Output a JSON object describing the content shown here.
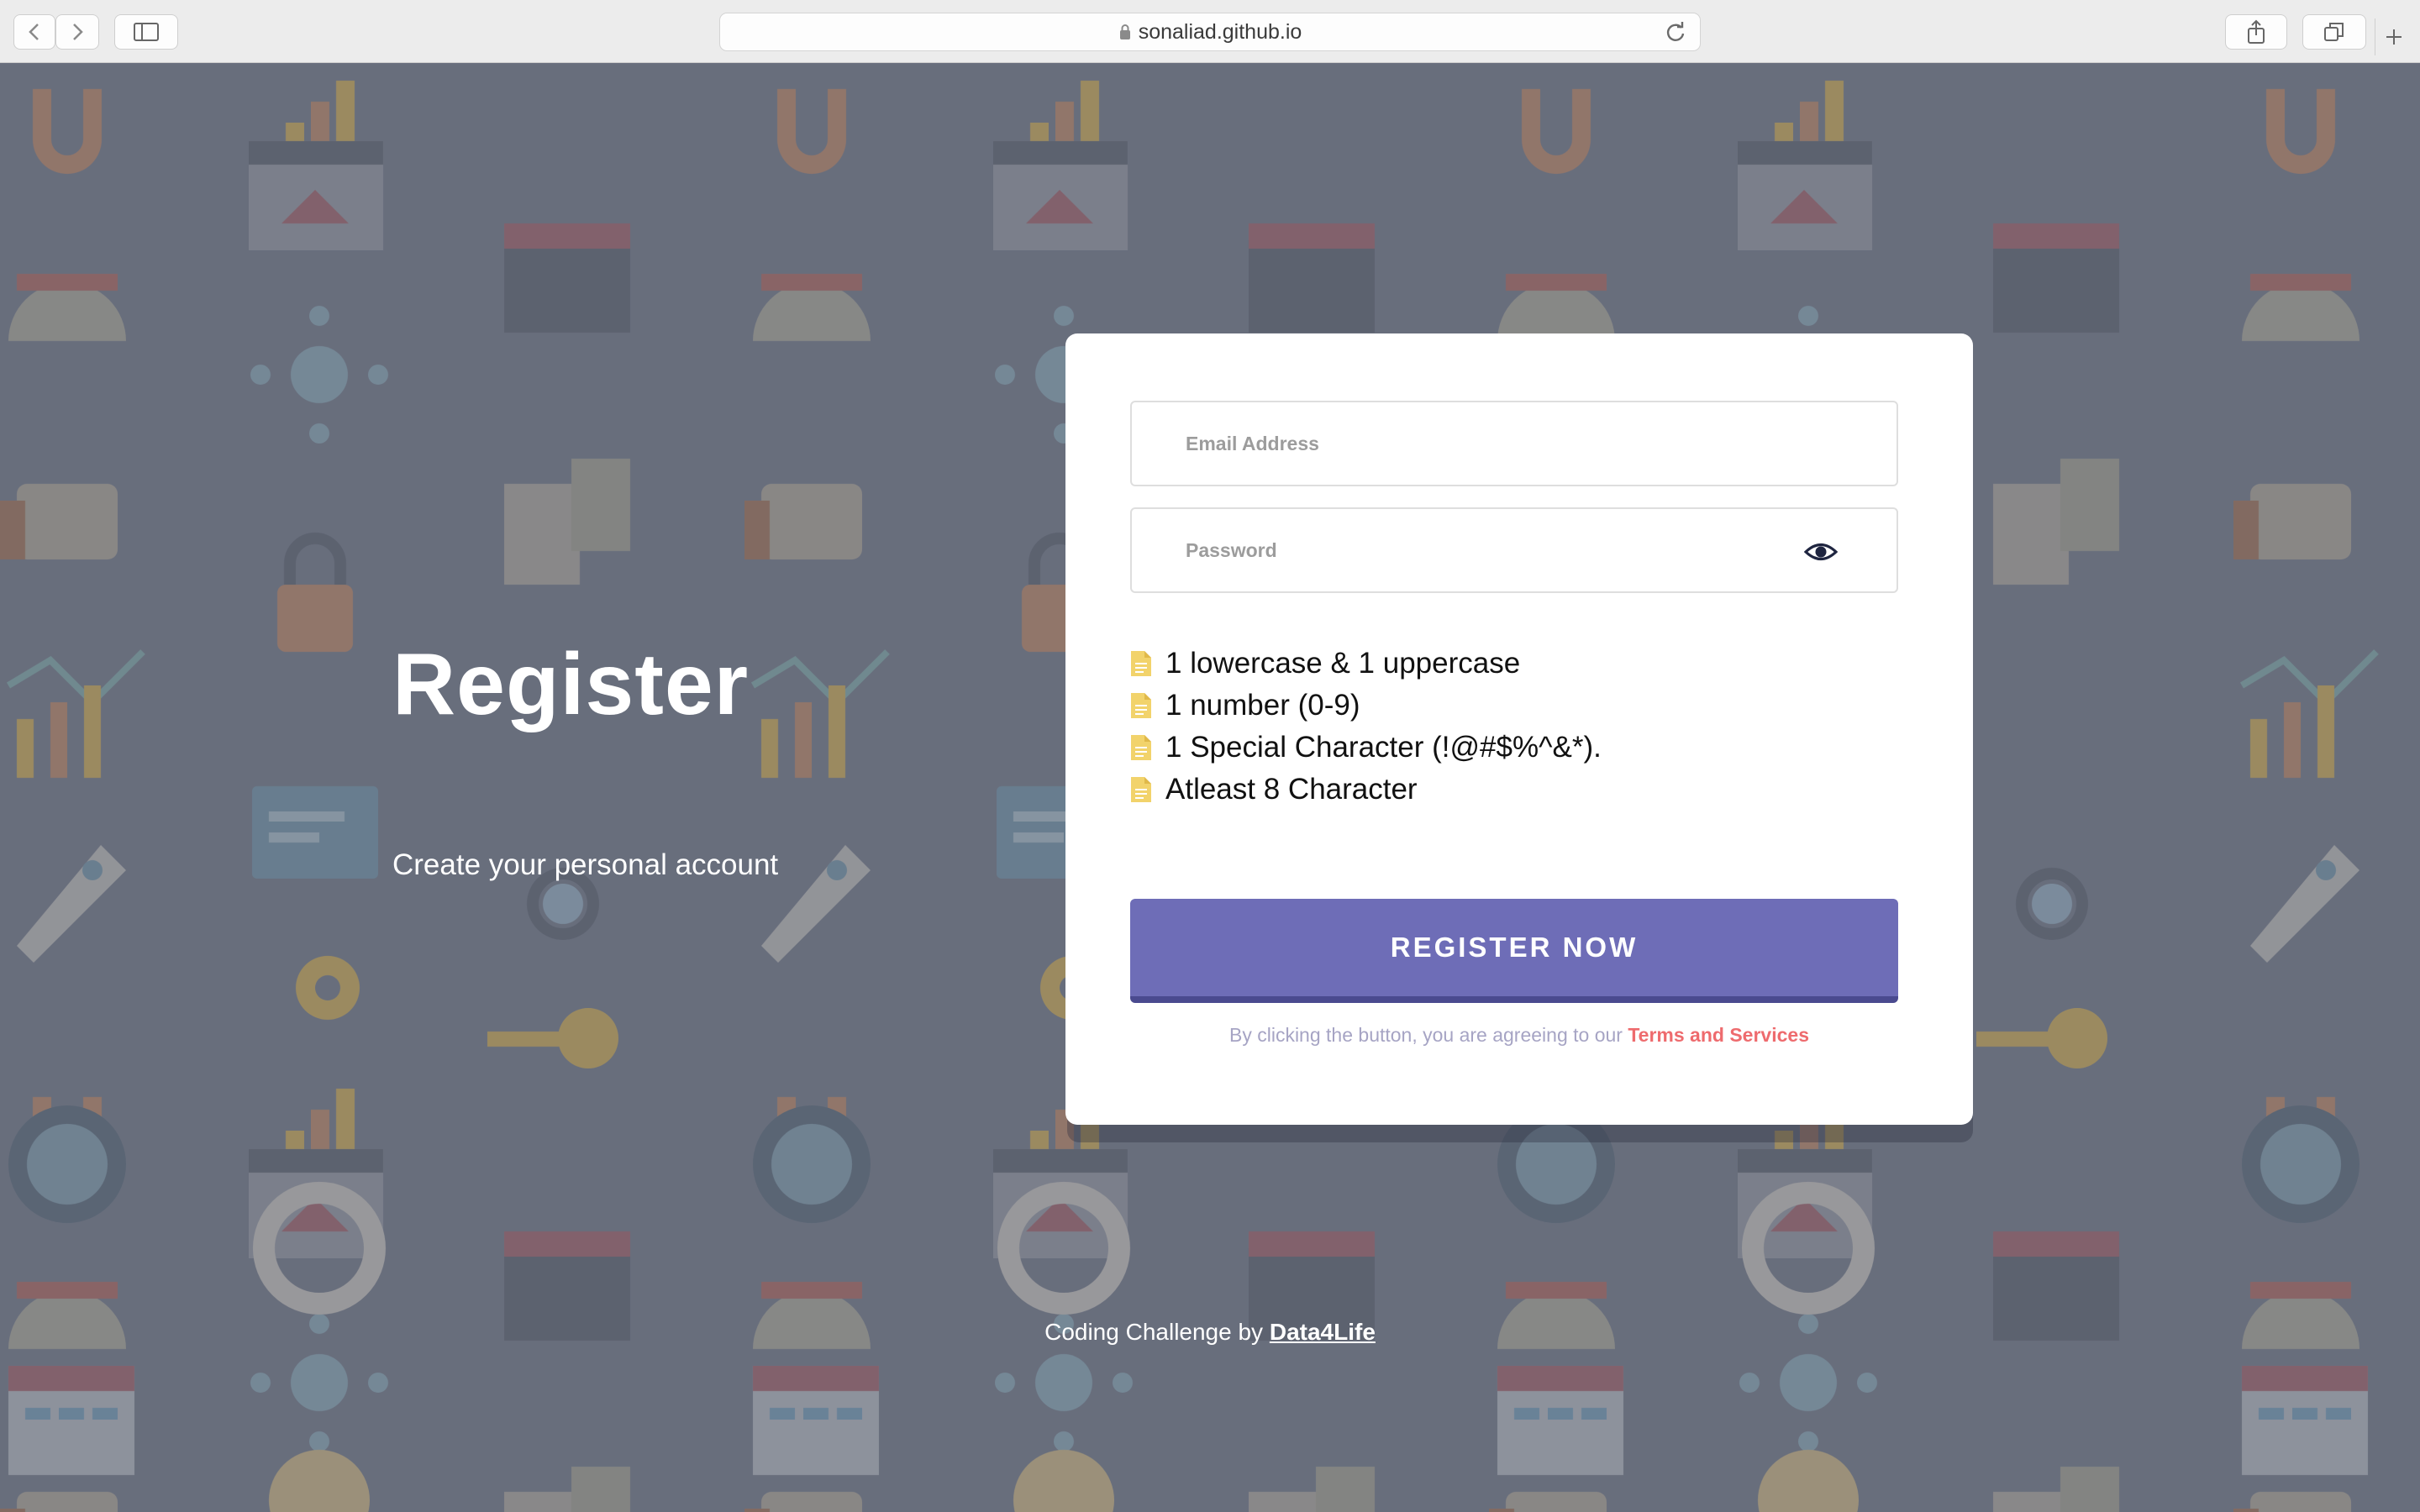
{
  "browser": {
    "url": "sonaliad.github.io"
  },
  "hero": {
    "title": "Register",
    "subtitle": "Create your personal account"
  },
  "form": {
    "email_placeholder": "Email Address",
    "password_placeholder": "Password",
    "rules": [
      "1 lowercase & 1 uppercase",
      "1 number (0-9)",
      "1 Special Character (!@#$%^&*).",
      "Atleast 8 Character"
    ],
    "submit_label": "REGISTER NOW",
    "agree_text": "By clicking the button, you are agreeing to our",
    "terms_link": "Terms and Services"
  },
  "footer": {
    "text": "Coding Challenge by",
    "link": "Data4Life"
  },
  "colors": {
    "accent": "#6e6db7",
    "terms": "#ee6b6e",
    "rule_icon": "#f2d36b"
  }
}
